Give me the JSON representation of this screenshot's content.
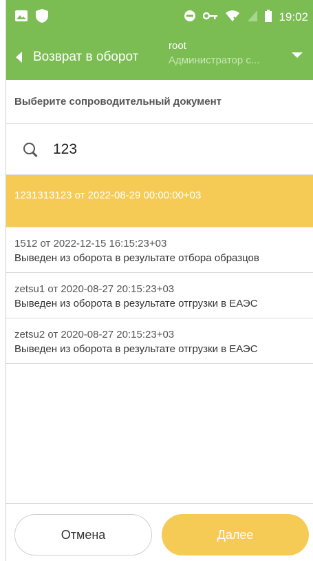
{
  "status_bar": {
    "time": "19:02",
    "icons": [
      "image-icon",
      "shield-icon",
      "do-not-disturb-icon",
      "key-icon",
      "wifi-off-icon",
      "no-sim-icon",
      "battery-icon"
    ]
  },
  "toolbar": {
    "title": "Возврат в оборот",
    "user_name": "root",
    "user_role": "Администратор с..."
  },
  "prompt": "Выберите сопроводительный документ",
  "search": {
    "value": "123"
  },
  "documents": [
    {
      "title": "1231313123 от 2022-08-29 00:00:00+03",
      "subtitle": "",
      "selected": true
    },
    {
      "title": "1512 от 2022-12-15 16:15:23+03",
      "subtitle": "Выведен из оборота в результате отбора образцов",
      "selected": false
    },
    {
      "title": "zetsu1 от 2020-08-27 20:15:23+03",
      "subtitle": "Выведен из оборота в результате отгрузки в ЕАЭС",
      "selected": false
    },
    {
      "title": "zetsu2 от 2020-08-27 20:15:23+03",
      "subtitle": "Выведен из оборота в результате отгрузки в ЕАЭС",
      "selected": false
    }
  ],
  "buttons": {
    "cancel": "Отмена",
    "next": "Далее"
  },
  "colors": {
    "header_green": "#7bbd52",
    "accent_yellow": "#f6cb55"
  }
}
